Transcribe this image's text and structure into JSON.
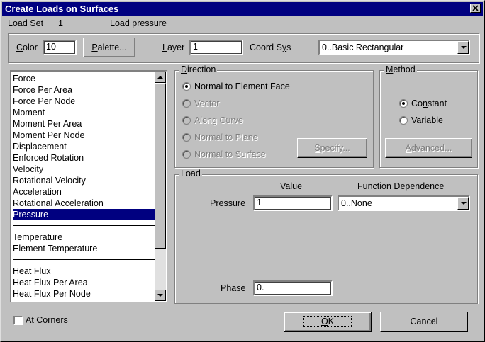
{
  "window": {
    "title": "Create Loads on Surfaces",
    "close_glyph": "✕"
  },
  "header": {
    "load_set_label": "Load Set",
    "load_set_value": "1",
    "load_set_name": "Load pressure"
  },
  "color": {
    "label": "Color",
    "value": "10",
    "palette_button": "Palette..."
  },
  "layer": {
    "label": "Layer",
    "value": "1"
  },
  "coordsys": {
    "label": "Coord Sys",
    "value": "0..Basic Rectangular"
  },
  "load_types": {
    "group1": [
      "Force",
      "Force Per Area",
      "Force Per Node",
      "Moment",
      "Moment Per Area",
      "Moment Per Node",
      "Displacement",
      "Enforced Rotation",
      "Velocity",
      "Rotational Velocity",
      "Acceleration",
      "Rotational Acceleration",
      "Pressure"
    ],
    "group2": [
      "Temperature",
      "Element Temperature"
    ],
    "group3": [
      "Heat Flux",
      "Heat Flux Per Area",
      "Heat Flux Per Node"
    ],
    "selected": "Pressure"
  },
  "direction": {
    "title": "Direction",
    "options": [
      "Normal to Element Face",
      "Vector",
      "Along Curve",
      "Normal to Plane",
      "Normal to Surface"
    ],
    "selected": "Normal to Element Face",
    "specify_button": "Specify..."
  },
  "method": {
    "title": "Method",
    "options": [
      "Constant",
      "Variable"
    ],
    "selected": "Constant",
    "advanced_button": "Advanced..."
  },
  "load": {
    "title": "Load",
    "value_header": "Value",
    "function_header": "Function Dependence",
    "pressure_label": "Pressure",
    "pressure_value": "1",
    "function_value": "0..None",
    "phase_label": "Phase",
    "phase_value": "0."
  },
  "at_corners": {
    "label": "At Corners",
    "checked": false
  },
  "buttons": {
    "ok": "OK",
    "cancel": "Cancel"
  }
}
